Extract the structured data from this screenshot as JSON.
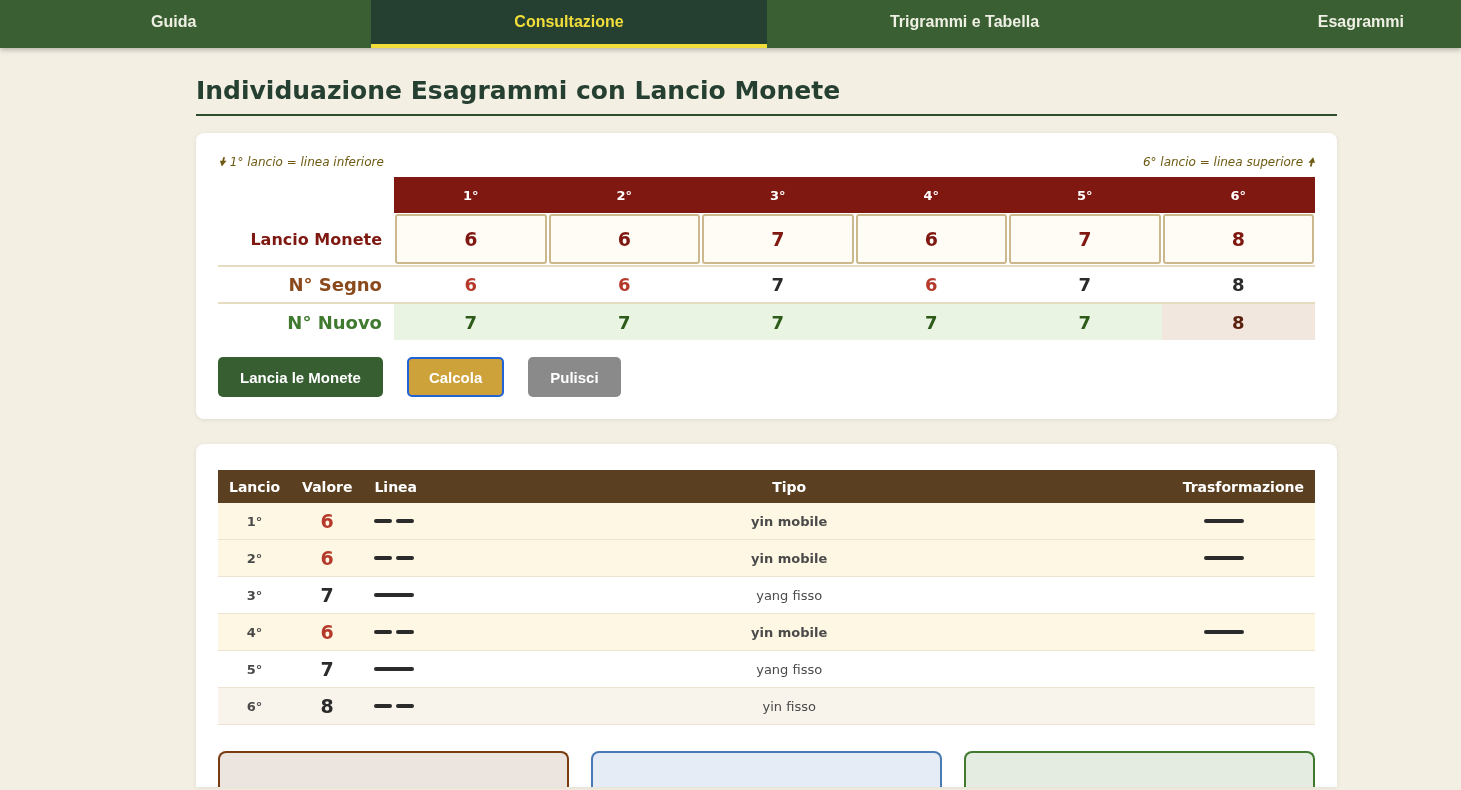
{
  "nav": {
    "tabs": [
      {
        "label": "Guida",
        "selected": false
      },
      {
        "label": "Consultazione",
        "selected": true
      },
      {
        "label": "Trigrammi e Tabella",
        "selected": false
      },
      {
        "label": "Esagrammi",
        "selected": false
      }
    ]
  },
  "title": "Individuazione Esagrammi con Lancio Monete",
  "throw_card": {
    "note_left": "🠟 1° lancio = linea inferiore",
    "note_right": "6° lancio = linea superiore 🠝",
    "row_labels": [
      "Lancio Monete",
      "N° Segno",
      "N° Nuovo"
    ],
    "throws": [
      {
        "ordinal": "1°",
        "coins": "6",
        "sign": "6",
        "moving": true,
        "new": "7",
        "new_yin": false
      },
      {
        "ordinal": "2°",
        "coins": "6",
        "sign": "6",
        "moving": true,
        "new": "7",
        "new_yin": false
      },
      {
        "ordinal": "3°",
        "coins": "7",
        "sign": "7",
        "moving": false,
        "new": "7",
        "new_yin": false
      },
      {
        "ordinal": "4°",
        "coins": "6",
        "sign": "6",
        "moving": true,
        "new": "7",
        "new_yin": false
      },
      {
        "ordinal": "5°",
        "coins": "7",
        "sign": "7",
        "moving": false,
        "new": "7",
        "new_yin": false
      },
      {
        "ordinal": "6°",
        "coins": "8",
        "sign": "8",
        "moving": false,
        "new": "8",
        "new_yin": true
      }
    ],
    "buttons": [
      {
        "label": "Lancia le Monete",
        "kind": "primary",
        "focused": false
      },
      {
        "label": "Calcola",
        "kind": "accent",
        "focused": true
      },
      {
        "label": "Pulisci",
        "kind": "neutral",
        "focused": false
      }
    ]
  },
  "result_table": {
    "columns": [
      "Lancio",
      "Valore",
      "Linea",
      "Tipo",
      "Trasformazione"
    ],
    "rows": [
      {
        "ordinal": "1°",
        "value": "6",
        "moving": true,
        "broken": true,
        "type": "yin mobile",
        "transformed": true
      },
      {
        "ordinal": "2°",
        "value": "6",
        "moving": true,
        "broken": true,
        "type": "yin mobile",
        "transformed": true
      },
      {
        "ordinal": "3°",
        "value": "7",
        "moving": false,
        "broken": false,
        "type": "yang fisso",
        "transformed": false
      },
      {
        "ordinal": "4°",
        "value": "6",
        "moving": true,
        "broken": true,
        "type": "yin mobile",
        "transformed": true
      },
      {
        "ordinal": "5°",
        "value": "7",
        "moving": false,
        "broken": false,
        "type": "yang fisso",
        "transformed": false
      },
      {
        "ordinal": "6°",
        "value": "8",
        "moving": false,
        "broken": true,
        "type": "yin fisso",
        "transformed": false
      }
    ]
  },
  "hexagram_panels": [
    {
      "color": "#7a3b12"
    },
    {
      "color": "#4a7ab5"
    },
    {
      "color": "#3f7a2e"
    }
  ]
}
